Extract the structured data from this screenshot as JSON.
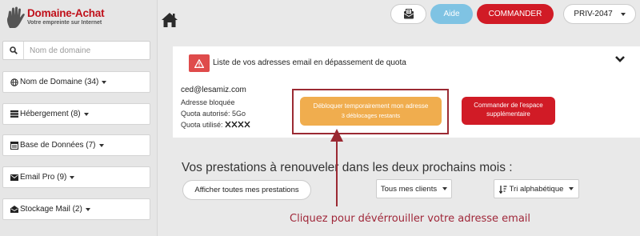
{
  "brand": {
    "title": "Domaine-Achat",
    "tagline": "Votre empreinte sur Internet",
    "color": "#c0101a"
  },
  "sidebar": {
    "search": {
      "placeholder": "Nom de domaine",
      "value": ""
    },
    "items": [
      {
        "label": "Nom de Domaine (34)",
        "icon": "globe-icon"
      },
      {
        "label": "Hébergement (8)",
        "icon": "server-icon"
      },
      {
        "label": "Base de Données (7)",
        "icon": "database-icon"
      },
      {
        "label": "Email Pro (9)",
        "icon": "envelope-icon"
      },
      {
        "label": "Stockage Mail (2)",
        "icon": "mail-box-icon"
      }
    ]
  },
  "topbar": {
    "help_label": "Aide",
    "order_label": "COMMANDER",
    "account_label": "PRIV-2047"
  },
  "quota": {
    "title": "Liste de vos adresses email en dépassement de quota",
    "email": "ced@lesamiz.com",
    "status": "Adresse bloquée",
    "authorized": "Quota autorisé: 5Go",
    "used_label": "Quota utilisé:",
    "unlock_line1": "Débloquer temporairement mon adresse",
    "unlock_line2": "3 déblocages restants",
    "order_space_line1": "Commander de l'espace",
    "order_space_line2": "supplémentaire"
  },
  "renewals": {
    "title": "Vos prestations à renouveler dans les deux prochains mois :",
    "show_all_label": "Afficher toutes mes prestations",
    "clients_dropdown": "Tous mes clients",
    "sort_dropdown": "Tri alphabétique"
  },
  "annotation": "Cliquez pour dévérrouiller votre adresse email",
  "colors": {
    "red": "#d11b26",
    "blue": "#7fc3e3",
    "orange": "#f0ad4e",
    "annotation": "#a0283a"
  }
}
